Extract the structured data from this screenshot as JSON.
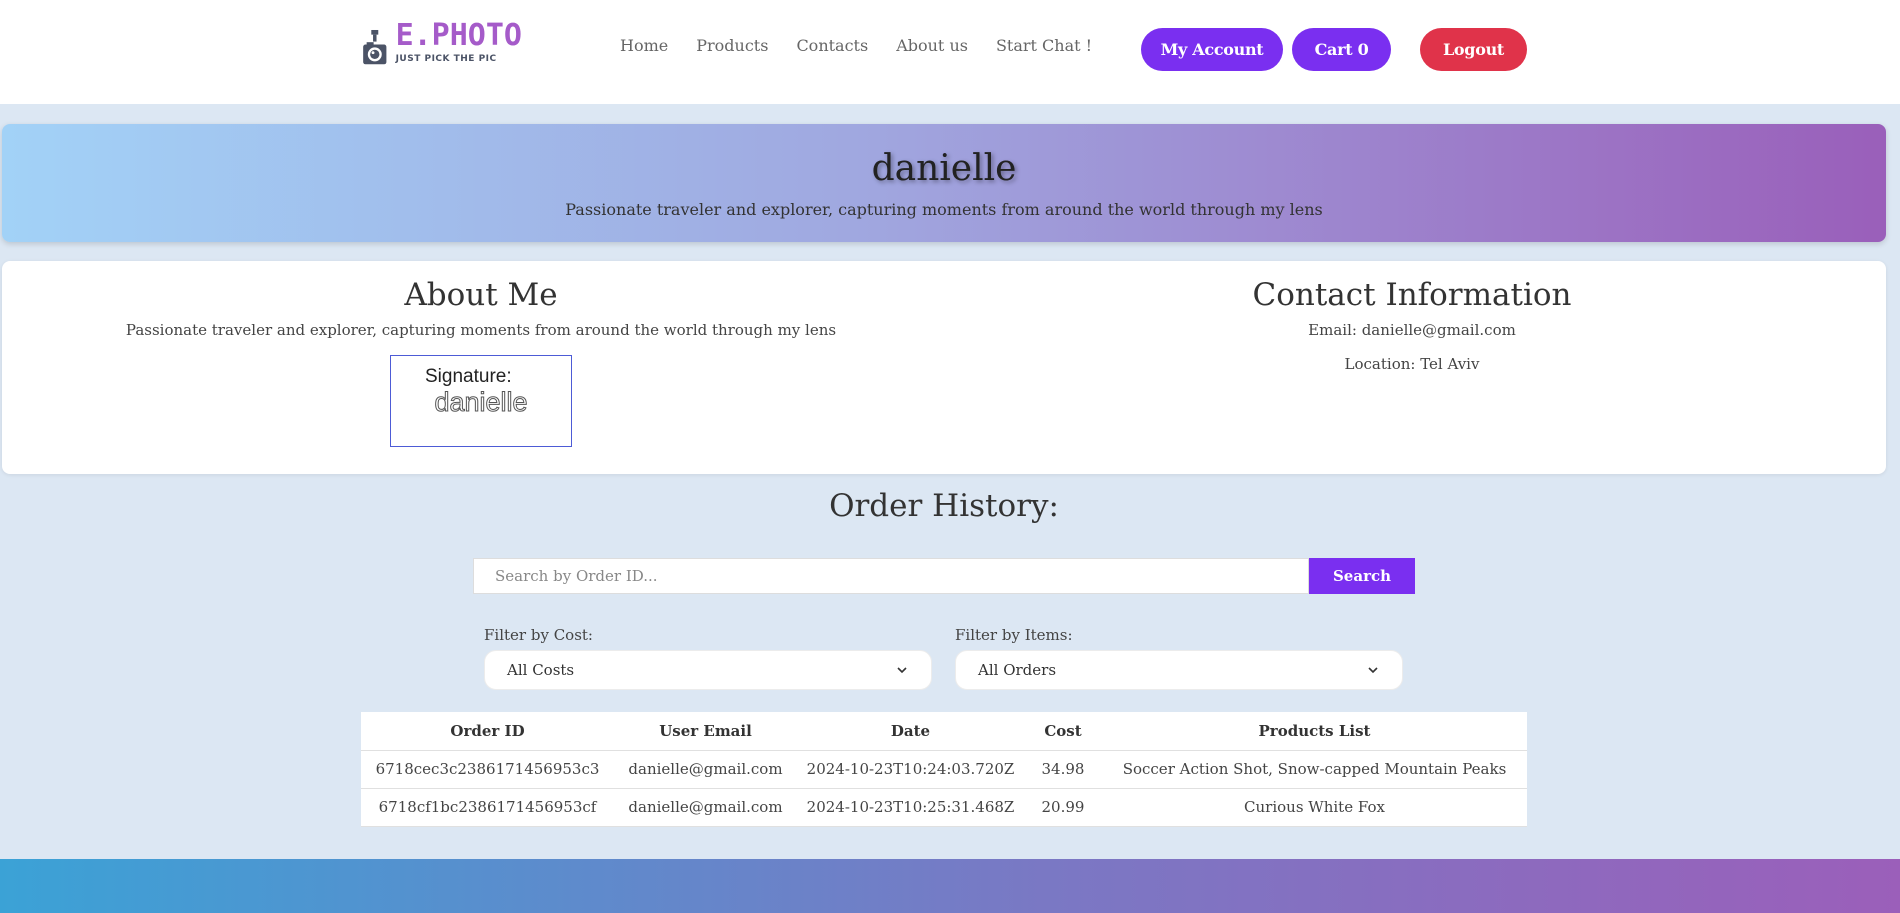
{
  "brand": {
    "title": "E.PHOTO",
    "tagline": "JUST PICK THE PIC",
    "accent": "#a55bc9"
  },
  "nav": {
    "items": [
      {
        "label": "Home"
      },
      {
        "label": "Products"
      },
      {
        "label": "Contacts"
      },
      {
        "label": "About us"
      },
      {
        "label": "Start Chat !"
      }
    ]
  },
  "header_actions": {
    "account_label": "My Account",
    "cart_label": "Cart 0",
    "logout_label": "Logout"
  },
  "profile": {
    "username": "danielle",
    "bio": "Passionate traveler and explorer, capturing moments from around the world through my lens"
  },
  "about": {
    "title": "About Me",
    "text": "Passionate traveler and explorer, capturing moments from around the world through my lens",
    "signature_label": "Signature:",
    "signature_name": "danielle"
  },
  "contact": {
    "title": "Contact Information",
    "email_line": "Email: danielle@gmail.com",
    "location_line": "Location: Tel Aviv"
  },
  "orders": {
    "title": "Order History:",
    "search_placeholder": "Search by Order ID...",
    "search_button": "Search",
    "filter_cost_label": "Filter by Cost:",
    "filter_cost_value": "All Costs",
    "filter_items_label": "Filter by Items:",
    "filter_items_value": "All Orders",
    "columns": [
      "Order ID",
      "User Email",
      "Date",
      "Cost",
      "Products List"
    ],
    "rows": [
      [
        "6718cec3c2386171456953c3",
        "danielle@gmail.com",
        "2024-10-23T10:24:03.720Z",
        "34.98",
        "Soccer Action Shot, Snow-capped Mountain Peaks"
      ],
      [
        "6718cf1bc2386171456953cf",
        "danielle@gmail.com",
        "2024-10-23T10:25:31.468Z",
        "20.99",
        "Curious White Fox"
      ]
    ]
  },
  "colors": {
    "primary_button": "#7a2ff0",
    "logout_button": "#e0334a",
    "page_background": "#dce7f3"
  }
}
